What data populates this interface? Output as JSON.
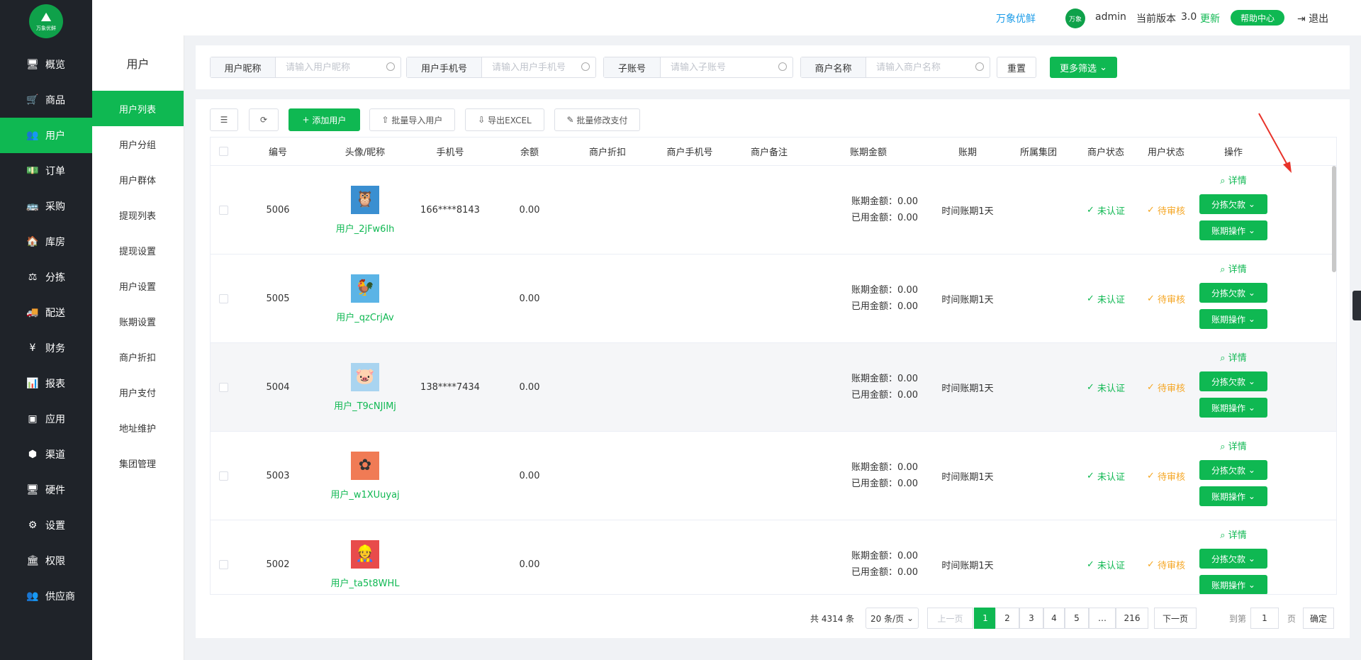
{
  "brand": {
    "logo_text": "万象优鲜",
    "logo_glyph": "⛰"
  },
  "sidebar": {
    "items": [
      {
        "icon": "monitor-icon",
        "glyph": "🖥",
        "label": "概览"
      },
      {
        "icon": "cart-icon",
        "glyph": "🛒",
        "label": "商品"
      },
      {
        "icon": "users-icon",
        "glyph": "👥",
        "label": "用户",
        "active": true
      },
      {
        "icon": "money-icon",
        "glyph": "💵",
        "label": "订单"
      },
      {
        "icon": "truck-icon",
        "glyph": "🚌",
        "label": "采购"
      },
      {
        "icon": "home-icon",
        "glyph": "🏠",
        "label": "库房"
      },
      {
        "icon": "scale-icon",
        "glyph": "⚖",
        "label": "分拣"
      },
      {
        "icon": "delivery-icon",
        "glyph": "🚚",
        "label": "配送"
      },
      {
        "icon": "yen-icon",
        "glyph": "¥",
        "label": "财务"
      },
      {
        "icon": "chart-icon",
        "glyph": "📊",
        "label": "报表"
      },
      {
        "icon": "app-icon",
        "glyph": "▣",
        "label": "应用"
      },
      {
        "icon": "cube-icon",
        "glyph": "⬢",
        "label": "渠道"
      },
      {
        "icon": "hardware-icon",
        "glyph": "🖥",
        "label": "硬件"
      },
      {
        "icon": "puzzle-icon",
        "glyph": "⚙",
        "label": "设置"
      },
      {
        "icon": "bank-icon",
        "glyph": "🏛",
        "label": "权限"
      },
      {
        "icon": "supplier-icon",
        "glyph": "👥",
        "label": "供应商"
      }
    ]
  },
  "subnav": {
    "title": "用户",
    "items": [
      "用户列表",
      "用户分组",
      "用户群体",
      "提现列表",
      "提现设置",
      "用户设置",
      "账期设置",
      "商户折扣",
      "用户支付",
      "地址维护",
      "集团管理"
    ]
  },
  "topbar": {
    "brand_link": "万象优鲜",
    "avatar_text": "万象",
    "user": "admin",
    "version_label": "当前版本",
    "version": "3.0",
    "update": "更新",
    "help": "帮助中心",
    "logout": "退出"
  },
  "filters": {
    "nickname_label": "用户昵称",
    "nickname_placeholder": "请输入用户昵称",
    "phone_label": "用户手机号",
    "phone_placeholder": "请输入用户手机号",
    "subaccount_label": "子账号",
    "subaccount_placeholder": "请输入子账号",
    "merchant_label": "商户名称",
    "merchant_placeholder": "请输入商户名称",
    "reset": "重置",
    "more": "更多筛选"
  },
  "toolbar": {
    "add_user": "添加用户",
    "batch_import": "批量导入用户",
    "export": "导出EXCEL",
    "batch_pay": "批量修改支付"
  },
  "table": {
    "headers": [
      "编号",
      "头像/昵称",
      "手机号",
      "余额",
      "商户折扣",
      "商户手机号",
      "商户备注",
      "账期金额",
      "账期",
      "所属集团",
      "商户状态",
      "用户状态",
      "操作"
    ],
    "acct_amount_label": "账期金额：",
    "used_amount_label": "已用金额：",
    "rows": [
      {
        "id": "5006",
        "avatar": "🦉",
        "avatar_bg": "#3a8fd1",
        "nick": "用户_2jFw6lh",
        "phone": "166****8143",
        "balance": "0.00",
        "acct_amount": "0.00",
        "used_amount": "0.00",
        "period": "时间账期1天",
        "merchant_status": "未认证",
        "user_status": "待审核"
      },
      {
        "id": "5005",
        "avatar": "🐓",
        "avatar_bg": "#5bb4e6",
        "nick": "用户_qzCrjAv",
        "phone": "",
        "balance": "0.00",
        "acct_amount": "0.00",
        "used_amount": "0.00",
        "period": "时间账期1天",
        "merchant_status": "未认证",
        "user_status": "待审核"
      },
      {
        "id": "5004",
        "avatar": "🐷",
        "avatar_bg": "#a9d4f0",
        "nick": "用户_T9cNJlMj",
        "phone": "138****7434",
        "balance": "0.00",
        "acct_amount": "0.00",
        "used_amount": "0.00",
        "period": "时间账期1天",
        "merchant_status": "未认证",
        "user_status": "待审核"
      },
      {
        "id": "5003",
        "avatar": "✿",
        "avatar_bg": "#f07b55",
        "nick": "用户_w1XUuyaj",
        "phone": "",
        "balance": "0.00",
        "acct_amount": "0.00",
        "used_amount": "0.00",
        "period": "时间账期1天",
        "merchant_status": "未认证",
        "user_status": "待审核"
      },
      {
        "id": "5002",
        "avatar": "👷",
        "avatar_bg": "#e84b4b",
        "nick": "用户_ta5t8WHL",
        "phone": "",
        "balance": "0.00",
        "acct_amount": "0.00",
        "used_amount": "0.00",
        "period": "时间账期1天",
        "merchant_status": "未认证",
        "user_status": "待审核"
      }
    ],
    "op_detail": "详情",
    "op_debt": "分拣欠款",
    "op_acct": "账期操作"
  },
  "pagination": {
    "total": "共 4314 条",
    "page_size": "20 条/页",
    "prev": "上一页",
    "pages": [
      "1",
      "2",
      "3",
      "4",
      "5",
      "…",
      "216"
    ],
    "next": "下一页",
    "goto_label": "到第",
    "goto_value": "1",
    "page_unit": "页",
    "confirm": "确定"
  }
}
